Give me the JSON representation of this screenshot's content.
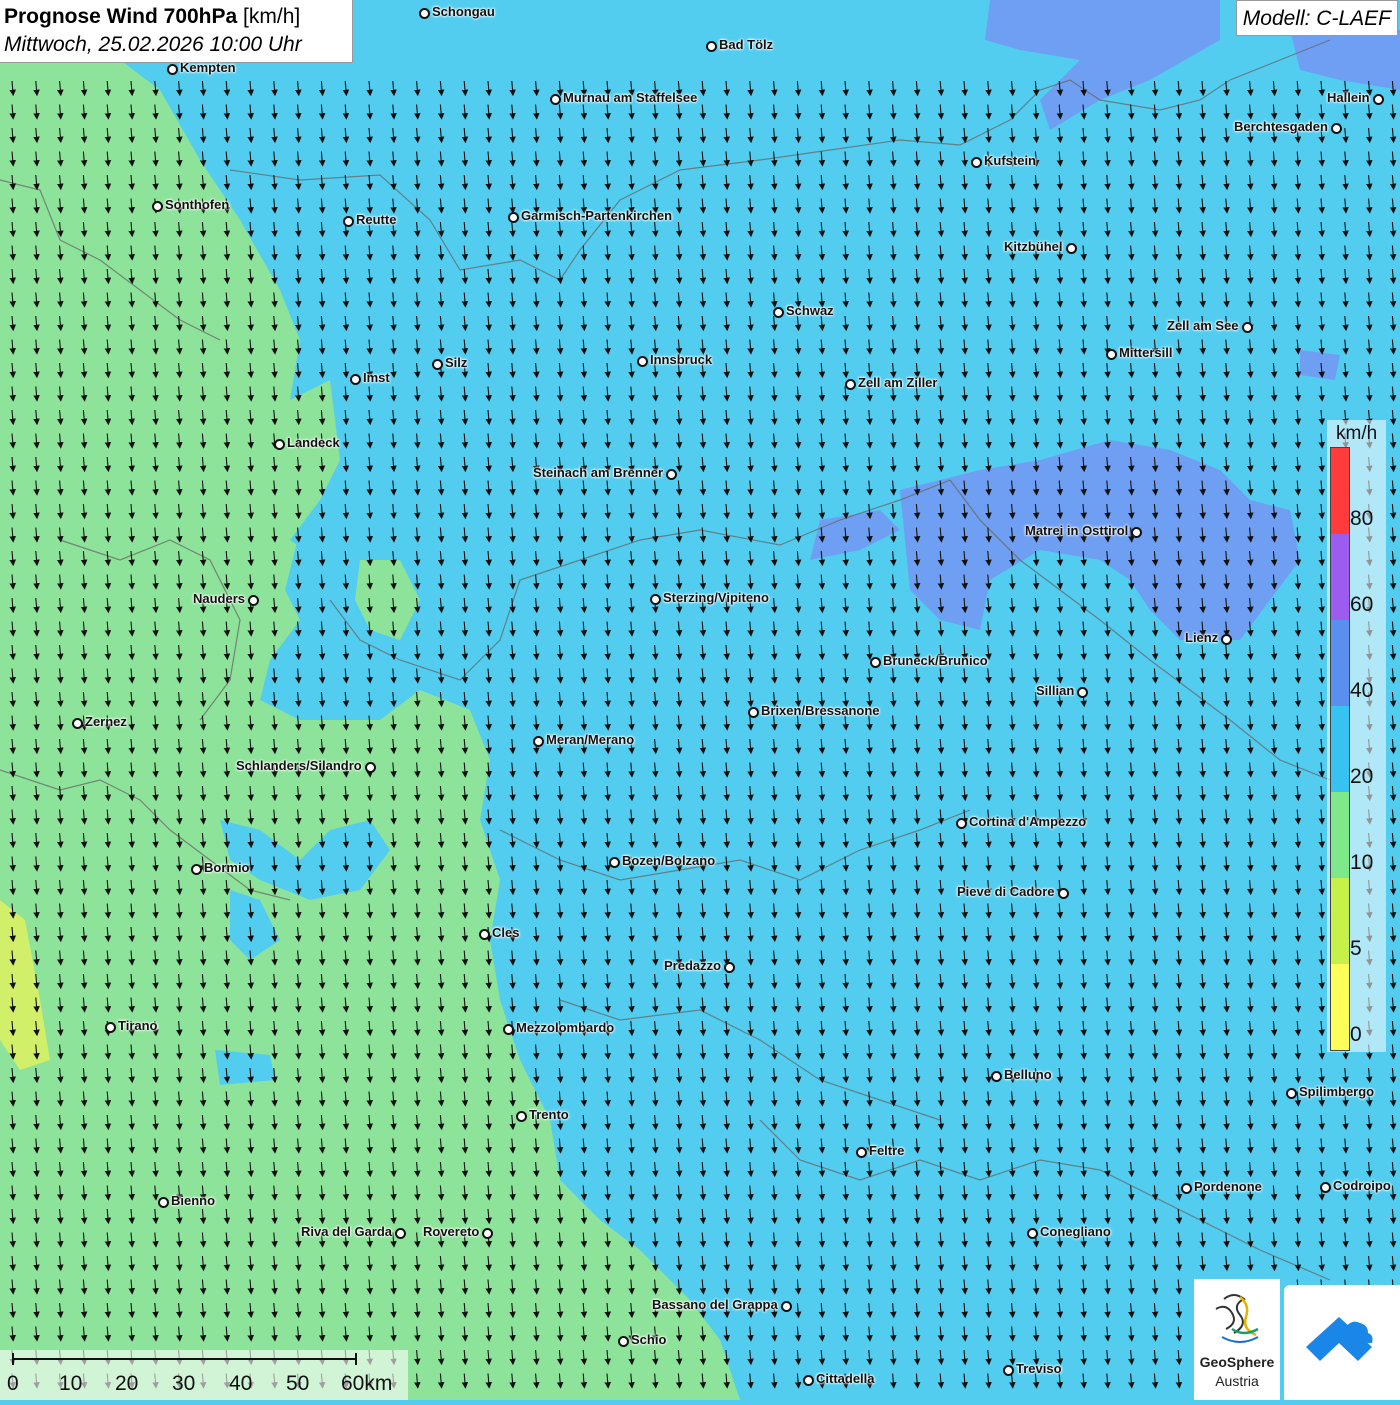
{
  "title": {
    "bold": "Prognose Wind 700hPa",
    "unit": " [km/h]",
    "datetime": "Mittwoch, 25.02.2026 10:00 Uhr"
  },
  "model": "Modell: C-LAEF",
  "legend": {
    "unit": "km/h",
    "ticks": [
      "80",
      "60",
      "40",
      "20",
      "10",
      "5",
      "0"
    ],
    "colors": [
      "#ff3b3b",
      "#9d5cf0",
      "#5a8ff0",
      "#36c3f2",
      "#7ee98a",
      "#c6f04a",
      "#ffff5a"
    ]
  },
  "scalebar": {
    "labels": [
      "0",
      "10",
      "20",
      "30",
      "40",
      "50",
      "60km"
    ]
  },
  "logos": {
    "geosphere_line1": "GeoSphere",
    "geosphere_line2": "Austria"
  },
  "wind": {
    "direction": "north",
    "speed_range_kmh": [
      10,
      40
    ]
  },
  "cities": [
    {
      "name": "Schongau"
    },
    {
      "name": "Bad Tölz"
    },
    {
      "name": "Kempten"
    },
    {
      "name": "Murnau am Staffelsee"
    },
    {
      "name": "Hallein"
    },
    {
      "name": "Berchtesgaden"
    },
    {
      "name": "Kufstein"
    },
    {
      "name": "Sonthofen"
    },
    {
      "name": "Reutte"
    },
    {
      "name": "Garmisch-Partenkirchen"
    },
    {
      "name": "Kitzbühel"
    },
    {
      "name": "Schwaz"
    },
    {
      "name": "Zell am See"
    },
    {
      "name": "Mittersill"
    },
    {
      "name": "Silz"
    },
    {
      "name": "Innsbruck"
    },
    {
      "name": "Imst"
    },
    {
      "name": "Zell am Ziller"
    },
    {
      "name": "Landeck"
    },
    {
      "name": "Steinach am Brenner"
    },
    {
      "name": "Matrei in Osttirol"
    },
    {
      "name": "Nauders"
    },
    {
      "name": "Sterzing/Vipiteno"
    },
    {
      "name": "Lienz"
    },
    {
      "name": "Bruneck/Brunico"
    },
    {
      "name": "Sillian"
    },
    {
      "name": "Brixen/Bressanone"
    },
    {
      "name": "Zernez"
    },
    {
      "name": "Meran/Merano"
    },
    {
      "name": "Schlanders/Silandro"
    },
    {
      "name": "Cortina d'Ampezzo"
    },
    {
      "name": "Bozen/Bolzano"
    },
    {
      "name": "Bormio"
    },
    {
      "name": "Pieve di Cadore"
    },
    {
      "name": "Cles"
    },
    {
      "name": "Predazzo"
    },
    {
      "name": "Tirano"
    },
    {
      "name": "Mezzolombardo"
    },
    {
      "name": "Belluno"
    },
    {
      "name": "Spilimbergo"
    },
    {
      "name": "Trento"
    },
    {
      "name": "Feltre"
    },
    {
      "name": "Pordenone"
    },
    {
      "name": "Codroipo"
    },
    {
      "name": "Bienno"
    },
    {
      "name": "Riva del Garda"
    },
    {
      "name": "Rovereto"
    },
    {
      "name": "Conegliano"
    },
    {
      "name": "Bassano del Grappa"
    },
    {
      "name": "Schio"
    },
    {
      "name": "Treviso"
    },
    {
      "name": "Cittadella"
    }
  ]
}
